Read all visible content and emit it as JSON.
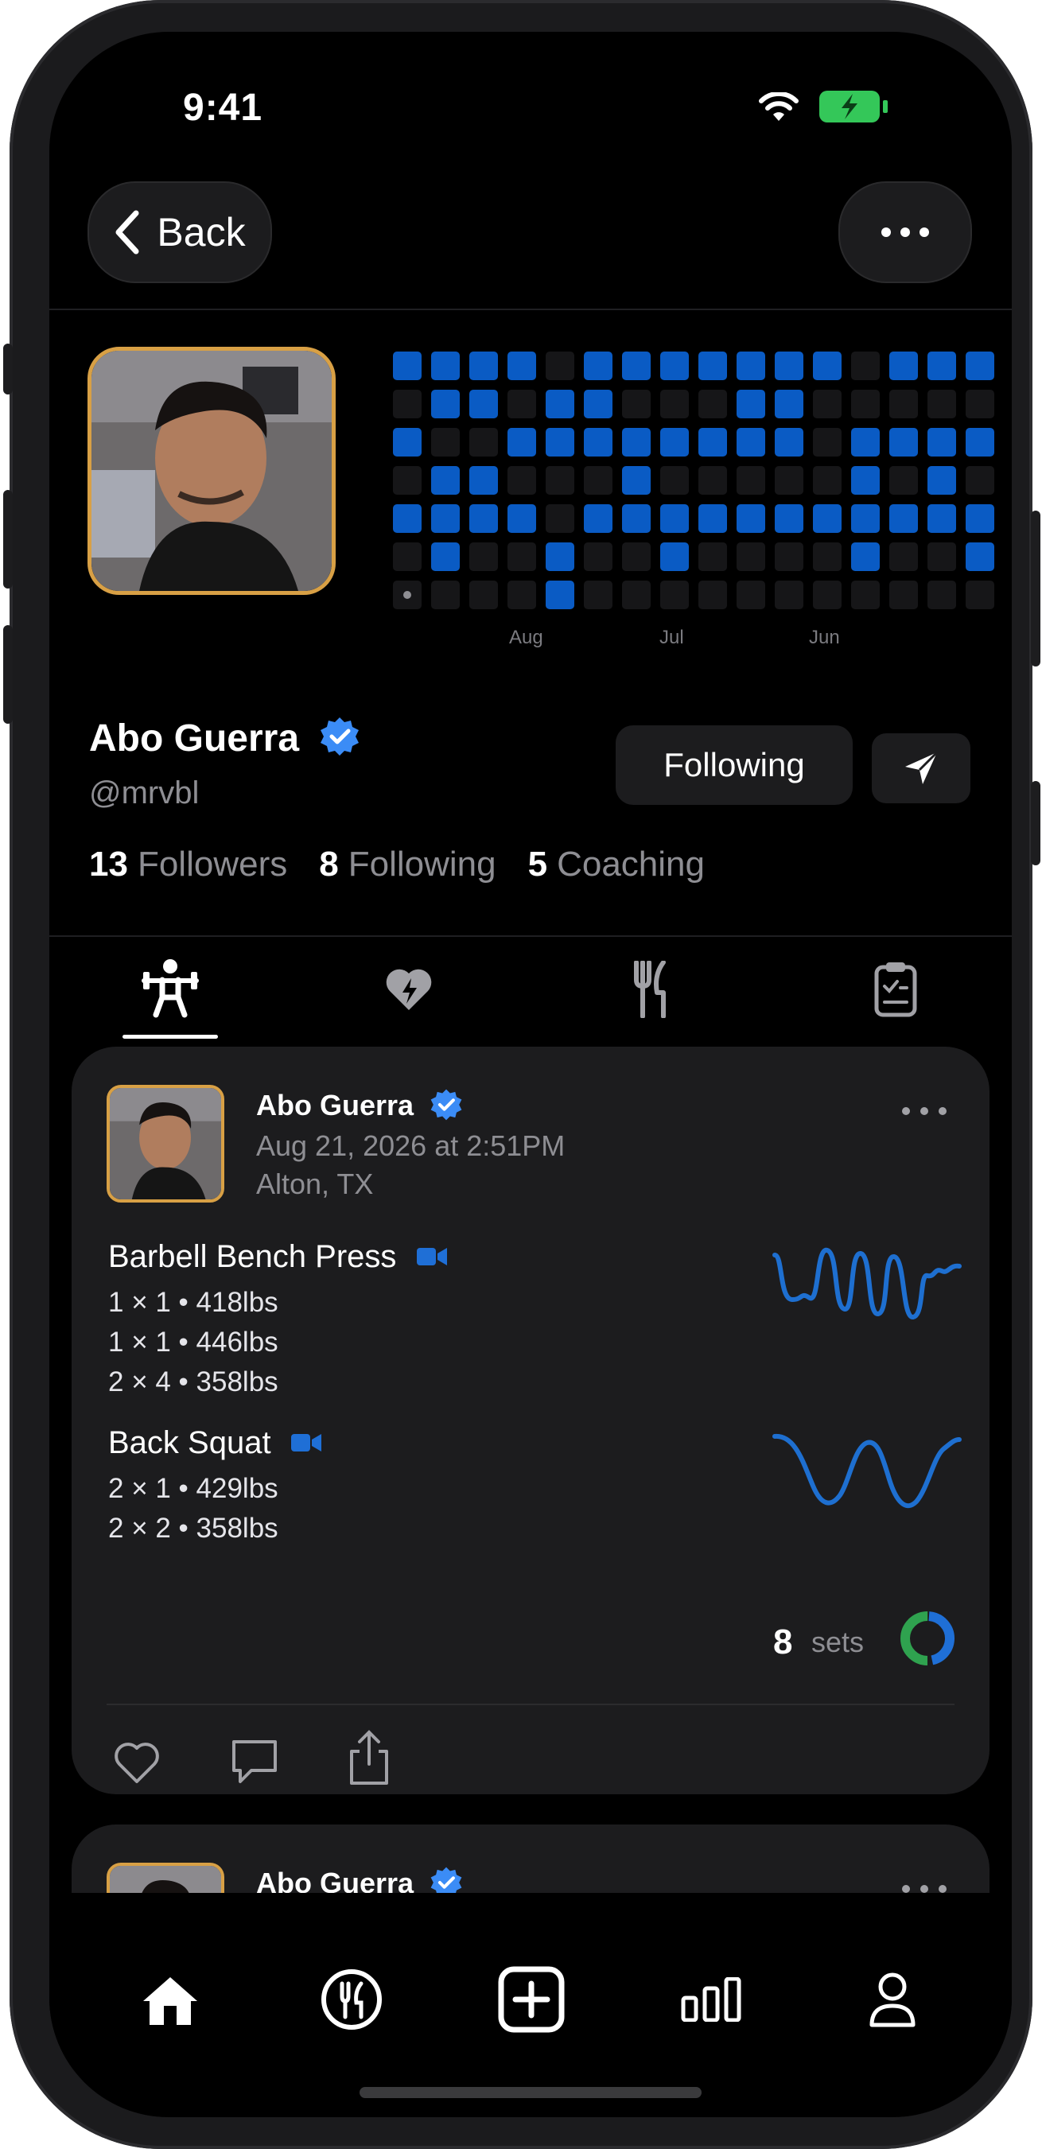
{
  "status": {
    "time": "9:41"
  },
  "nav": {
    "back_label": "Back"
  },
  "profile": {
    "name": "Abo Guerra",
    "handle": "@mrvbl",
    "following_button": "Following",
    "stats": [
      {
        "count": "13",
        "label": "Followers"
      },
      {
        "count": "8",
        "label": "Following"
      },
      {
        "count": "5",
        "label": "Coaching"
      }
    ]
  },
  "heatmap": {
    "months": [
      "Aug",
      "Jul",
      "Jun"
    ],
    "rows": [
      "1111011111110111",
      "0110110001100000",
      "1001111111101111",
      "0110001000001010",
      "1111011111111111",
      "0100100100001001",
      "0000100000000000"
    ]
  },
  "tabs": [
    "workouts",
    "health",
    "nutrition",
    "plans"
  ],
  "posts": [
    {
      "name": "Abo Guerra",
      "date": "Aug 21, 2026 at 2:51PM",
      "location": "Alton, TX",
      "exercises": [
        {
          "title": "Barbell Bench Press",
          "sets": [
            "1 × 1 • 418lbs",
            "1 × 1 • 446lbs",
            "2 × 4 • 358lbs"
          ]
        },
        {
          "title": "Back Squat",
          "sets": [
            "2 × 1 • 429lbs",
            "2 × 2 • 358lbs"
          ]
        }
      ],
      "sets_count": "8",
      "sets_label": "sets"
    },
    {
      "name": "Abo Guerra"
    }
  ],
  "colors": {
    "accent": "#0a5bc4",
    "verified": "#3b8cf6",
    "avatar_ring": "#d8a045",
    "ring_green": "#2fa24f",
    "ring_blue": "#1f6fd6"
  },
  "tabbar": [
    "home-icon",
    "nutrition-icon",
    "add-icon",
    "stats-icon",
    "profile-icon"
  ]
}
